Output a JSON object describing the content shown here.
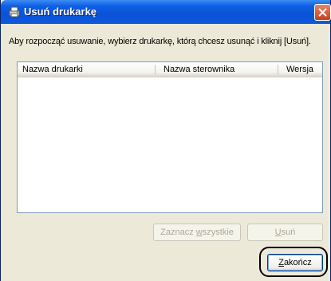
{
  "window": {
    "title": "Usuń drukarkę"
  },
  "instruction": "Aby rozpocząć usuwanie, wybierz drukarkę, którą chcesz usunąć i kliknij [Usuń].",
  "printer_list": {
    "columns": [
      "Nazwa drukarki",
      "Nazwa sterownika",
      "Wersja"
    ],
    "rows": []
  },
  "buttons": {
    "select_all_pre": "Zaznacz ",
    "select_all_key": "w",
    "select_all_post": "szystkie",
    "delete_key": "U",
    "delete_post": "suń",
    "finish_key": "Z",
    "finish_post": "akończ"
  },
  "colors": {
    "titlebar": "#0a52d6",
    "dialog_bg": "#ece9d8",
    "list_border": "#7f9db9"
  },
  "icons": {
    "app": "printer-shield-icon",
    "close": "close-icon"
  }
}
